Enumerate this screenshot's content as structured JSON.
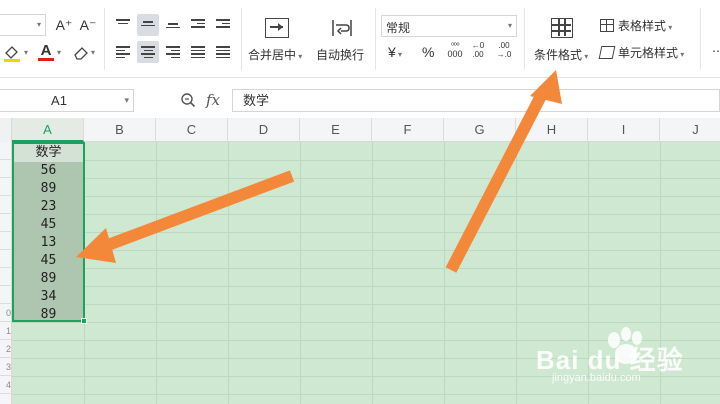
{
  "ribbon": {
    "font_increase_label": "A⁺",
    "font_decrease_label": "A⁻",
    "font_color_label": "A",
    "merge_center_label": "合并居中",
    "wrap_text_label": "自动换行",
    "number_format_value": "常规",
    "currency_symbol": "¥",
    "percent_symbol": "%",
    "thousands_symbol": "000",
    "conditional_format_label": "条件格式",
    "table_style_label": "表格样式",
    "cell_style_label": "单元格样式"
  },
  "formula_bar": {
    "name_box": "A1",
    "fx_label": "fx",
    "content": "数学"
  },
  "columns": [
    "A",
    "B",
    "C",
    "D",
    "E",
    "F",
    "G",
    "H",
    "I",
    "J"
  ],
  "column_a": {
    "header": "数学",
    "values": [
      "56",
      "89",
      "23",
      "45",
      "13",
      "45",
      "89",
      "34",
      "89"
    ]
  },
  "row_numbers_visible": [
    "0",
    "1",
    "2",
    "3",
    "4"
  ],
  "watermark": {
    "brand": "Bai du 经验",
    "url": "jingyan.baidu.com"
  },
  "colors": {
    "sheet_bg": "#cfe8d1",
    "selection_border": "#1aa35a",
    "arrow": "#f4883a"
  }
}
